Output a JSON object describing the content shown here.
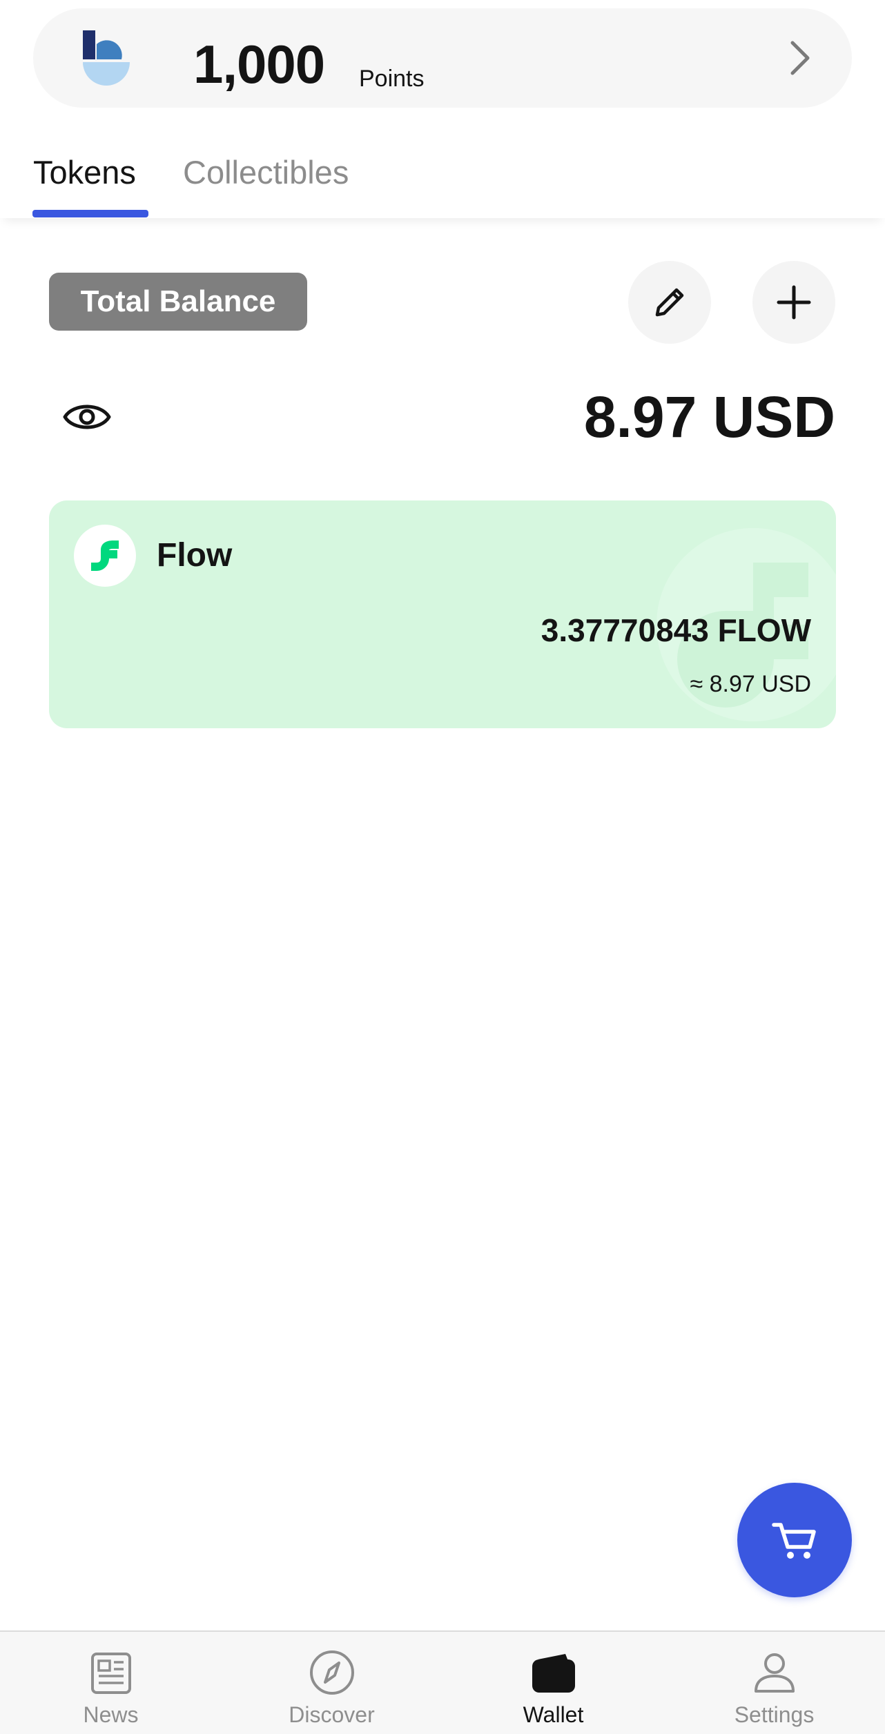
{
  "points": {
    "value": "1,000",
    "unit": "Points",
    "logo_icon": "brand-logo-icon",
    "chevron_icon": "chevron-right-icon"
  },
  "tabs": [
    {
      "label": "Tokens",
      "active": true
    },
    {
      "label": "Collectibles",
      "active": false
    }
  ],
  "balance": {
    "label": "Total Balance",
    "amount": "8.97 USD",
    "edit_icon": "pencil-icon",
    "add_icon": "plus-icon",
    "visibility_icon": "eye-icon"
  },
  "tokens": [
    {
      "name": "Flow",
      "amount": "3.37770843 FLOW",
      "fiat": "≈ 8.97 USD",
      "icon": "flow-logo-icon",
      "card_color": "#d6f7df",
      "brand_color": "#00d87e"
    }
  ],
  "fab": {
    "icon": "cart-icon",
    "color": "#3a57e0"
  },
  "nav": [
    {
      "label": "News",
      "icon": "news-icon",
      "active": false
    },
    {
      "label": "Discover",
      "icon": "compass-icon",
      "active": false
    },
    {
      "label": "Wallet",
      "icon": "wallet-icon",
      "active": true
    },
    {
      "label": "Settings",
      "icon": "user-icon",
      "active": false
    }
  ],
  "colors": {
    "accent": "#3a57e0",
    "badge_bg": "#7f7f7f",
    "inactive_text": "#8e8e8e"
  }
}
